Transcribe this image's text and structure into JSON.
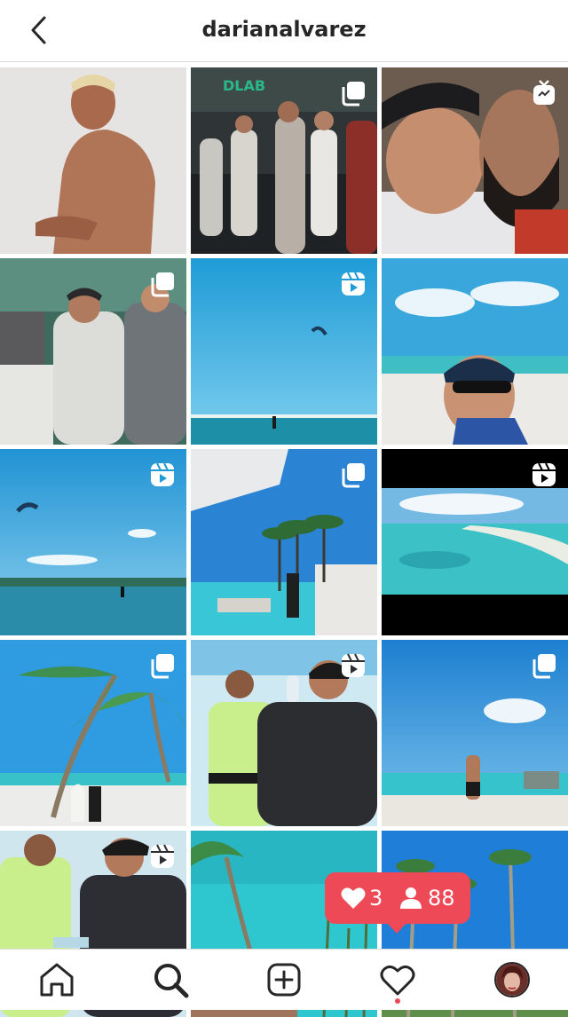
{
  "header": {
    "title": "darianalvarez",
    "back_icon": "chevron-left-icon"
  },
  "grid": {
    "rows": 5,
    "columns": 3,
    "tiles": [
      {
        "badge": "none"
      },
      {
        "badge": "carousel"
      },
      {
        "badge": "igtv"
      },
      {
        "badge": "carousel"
      },
      {
        "badge": "reels"
      },
      {
        "badge": "none"
      },
      {
        "badge": "reels"
      },
      {
        "badge": "carousel"
      },
      {
        "badge": "reels"
      },
      {
        "badge": "carousel"
      },
      {
        "badge": "reels"
      },
      {
        "badge": "carousel"
      },
      {
        "badge": "reels"
      },
      {
        "badge": "none"
      },
      {
        "badge": "none"
      }
    ]
  },
  "activity_popup": {
    "likes": "3",
    "followers": "88",
    "color": "#ed4956"
  },
  "navbar": {
    "items": [
      "home-icon",
      "search-icon",
      "new-post-icon",
      "activity-icon",
      "profile-avatar"
    ],
    "active": "search"
  }
}
